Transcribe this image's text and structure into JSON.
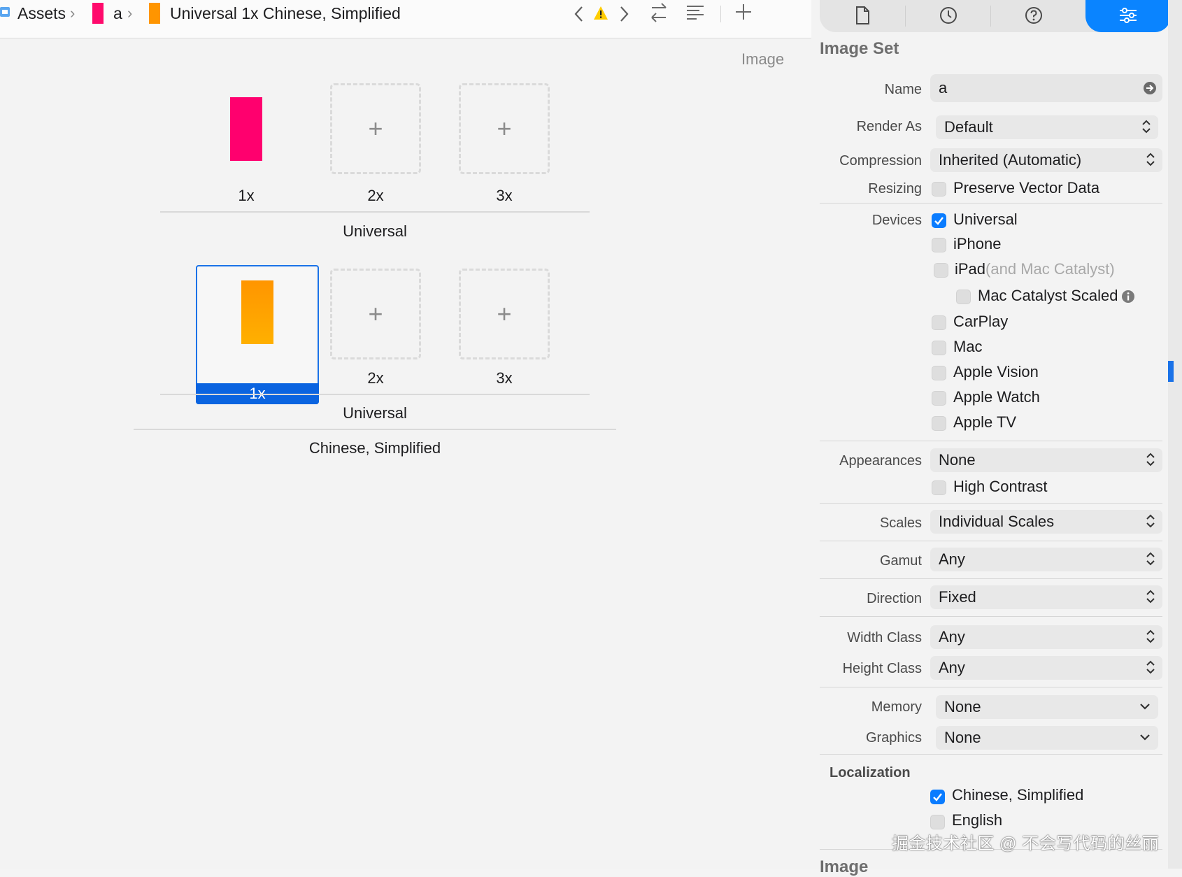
{
  "jumpbar": {
    "crumbs": [
      "Assets",
      "a",
      "Universal 1x Chinese, Simplified"
    ],
    "swatch_colors": [
      "#ff0a6c",
      "#ff9500"
    ]
  },
  "canvas": {
    "header": "Image",
    "groups": [
      {
        "label": "Universal",
        "scales": [
          "1x",
          "2x",
          "3x"
        ],
        "filled_color": "#ff006e",
        "plus": "+"
      },
      {
        "label": "Universal",
        "scales": [
          "1x",
          "2x",
          "3x"
        ],
        "filled_color": "#ff9500",
        "plus": "+"
      }
    ],
    "localization_label": "Chinese, Simplified"
  },
  "inspector": {
    "title": "Image Set",
    "name": {
      "label": "Name",
      "value": "a"
    },
    "render_as": {
      "label": "Render As",
      "value": "Default"
    },
    "compression": {
      "label": "Compression",
      "value": "Inherited (Automatic)"
    },
    "resizing": {
      "label": "Resizing",
      "option": "Preserve Vector Data",
      "checked": false
    },
    "devices": {
      "label": "Devices",
      "items": [
        {
          "label": "Universal",
          "checked": true
        },
        {
          "label": "iPhone",
          "checked": false
        },
        {
          "label": "iPad",
          "suffix": "(and Mac Catalyst)",
          "checked": false
        },
        {
          "label": "Mac Catalyst Scaled",
          "checked": false
        },
        {
          "label": "CarPlay",
          "checked": false
        },
        {
          "label": "Mac",
          "checked": false
        },
        {
          "label": "Apple Vision",
          "checked": false
        },
        {
          "label": "Apple Watch",
          "checked": false
        },
        {
          "label": "Apple TV",
          "checked": false
        }
      ]
    },
    "appearances": {
      "label": "Appearances",
      "value": "None",
      "high_contrast": "High Contrast"
    },
    "scales": {
      "label": "Scales",
      "value": "Individual Scales"
    },
    "gamut": {
      "label": "Gamut",
      "value": "Any"
    },
    "direction": {
      "label": "Direction",
      "value": "Fixed"
    },
    "width_class": {
      "label": "Width Class",
      "value": "Any"
    },
    "height_class": {
      "label": "Height Class",
      "value": "Any"
    },
    "memory": {
      "label": "Memory",
      "value": "None"
    },
    "graphics": {
      "label": "Graphics",
      "value": "None"
    },
    "localization": {
      "header": "Localization",
      "items": [
        {
          "label": "Chinese, Simplified",
          "checked": true
        },
        {
          "label": "English",
          "checked": false
        }
      ]
    },
    "next_section": "Image"
  },
  "watermark": "掘金技术社区 @ 不会写代码的丝丽",
  "accent_color": "#0a84ff",
  "icons": [
    "assets-icon",
    "warning-icon",
    "back-icon",
    "forward-icon",
    "swap-icon",
    "editor-options-icon",
    "add-icon",
    "file-inspector-icon",
    "history-icon",
    "help-icon",
    "attributes-inspector-icon",
    "info-icon",
    "go-arrow-icon"
  ]
}
